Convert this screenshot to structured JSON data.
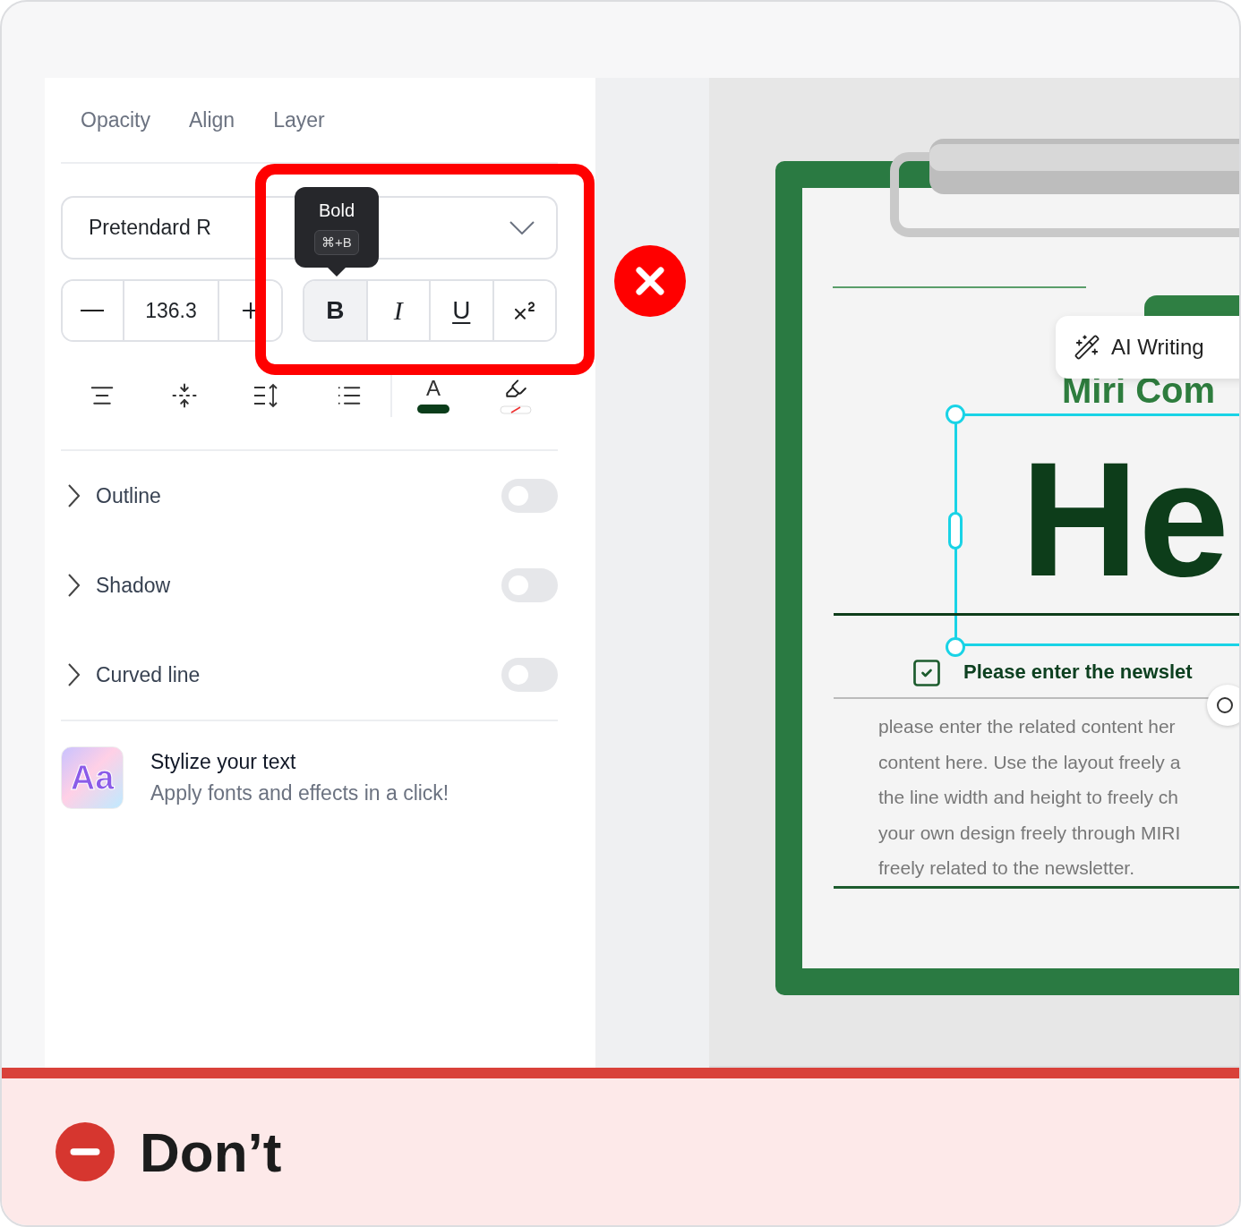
{
  "panel": {
    "tabs": [
      {
        "label": "Opacity"
      },
      {
        "label": "Align"
      },
      {
        "label": "Layer"
      }
    ],
    "font_select": {
      "value": "Pretendard R"
    },
    "size_stepper": {
      "value": "136.3"
    },
    "styles": [
      {
        "kind": "bold",
        "label": "B",
        "selected": true
      },
      {
        "kind": "italic",
        "label": "I",
        "selected": false
      },
      {
        "kind": "underline",
        "label": "U",
        "selected": false
      },
      {
        "kind": "superscript",
        "selected": false
      }
    ],
    "tooltip": {
      "title": "Bold",
      "shortcut": "⌘+B"
    },
    "tools": [
      {
        "kind": "align"
      },
      {
        "kind": "center"
      },
      {
        "kind": "spacing"
      },
      {
        "kind": "list"
      },
      {
        "kind": "text-color",
        "label": "A",
        "color": "#0b3d1a"
      },
      {
        "kind": "highlight"
      }
    ],
    "effects": [
      {
        "label": "Outline",
        "on": false
      },
      {
        "label": "Shadow",
        "on": false
      },
      {
        "label": "Curved line",
        "on": false
      }
    ],
    "promo": {
      "badge": "Aa",
      "title": "Stylize your text",
      "subtitle": "Apply fonts and effects in a click!"
    }
  },
  "canvas": {
    "ai_button": "AI Writing",
    "heading": "Miri Com",
    "big_text": "He",
    "subheading": "Please enter the newslet",
    "body": [
      "please enter the related content her",
      "content here. Use the layout freely a",
      "the line width and height to freely ch",
      "your own design freely through MIRI",
      "freely related to the newsletter."
    ]
  },
  "verdict": {
    "label": "Don’t"
  }
}
